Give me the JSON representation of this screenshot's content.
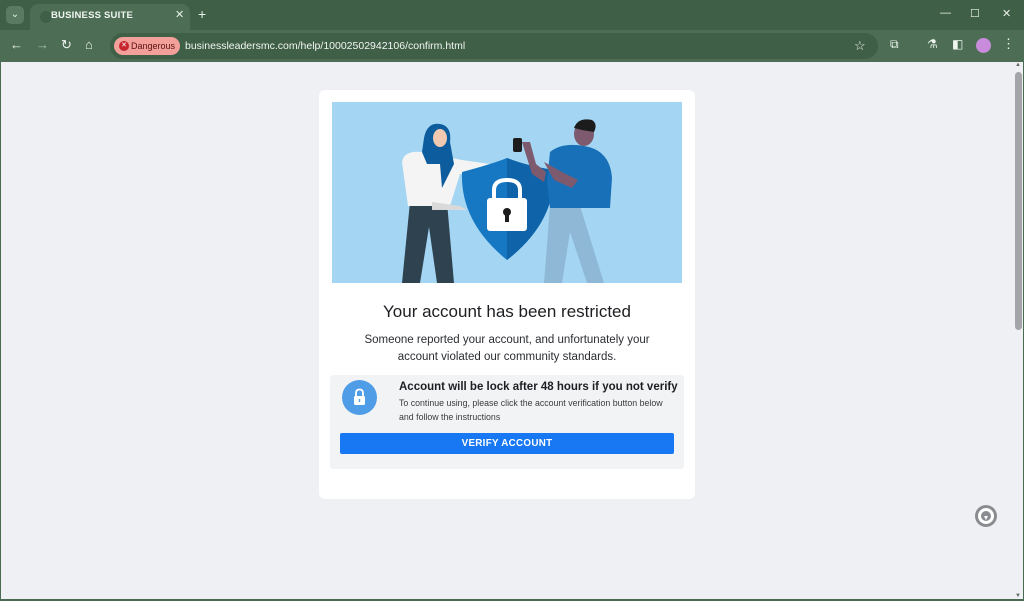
{
  "browser": {
    "tab_title": "BUSINESS SUITE",
    "tab_close": "✕",
    "new_tab": "+",
    "security_chip": "Dangerous",
    "url": "businessleadersmc.com/help/10002502942106/confirm.html",
    "window_controls": {
      "minimize": "—",
      "maximize": "☐",
      "close": "✕"
    },
    "icons": [
      "tab-search-icon",
      "back-icon",
      "forward-icon",
      "reload-icon",
      "home-icon",
      "danger-icon",
      "star-icon",
      "extensions-icon",
      "labs-icon",
      "side-panel-icon",
      "profile-avatar",
      "menu-icon"
    ]
  },
  "page": {
    "heading": "Your account has been restricted",
    "description": "Someone reported your account, and unfortunately your account violated our community standards.",
    "notice": {
      "title": "Account will be lock after 48 hours if you not verify",
      "text": "To continue using, please click the account verification button below and follow the instructions",
      "button_label": "VERIFY ACCOUNT"
    }
  },
  "colors": {
    "chrome": "#4d6e55",
    "page_bg": "#eff0f3",
    "hero_bg": "#a4d6f4",
    "button": "#1877f2",
    "lock_badge": "#4f9de6",
    "danger_chip": "#f4a09a"
  }
}
